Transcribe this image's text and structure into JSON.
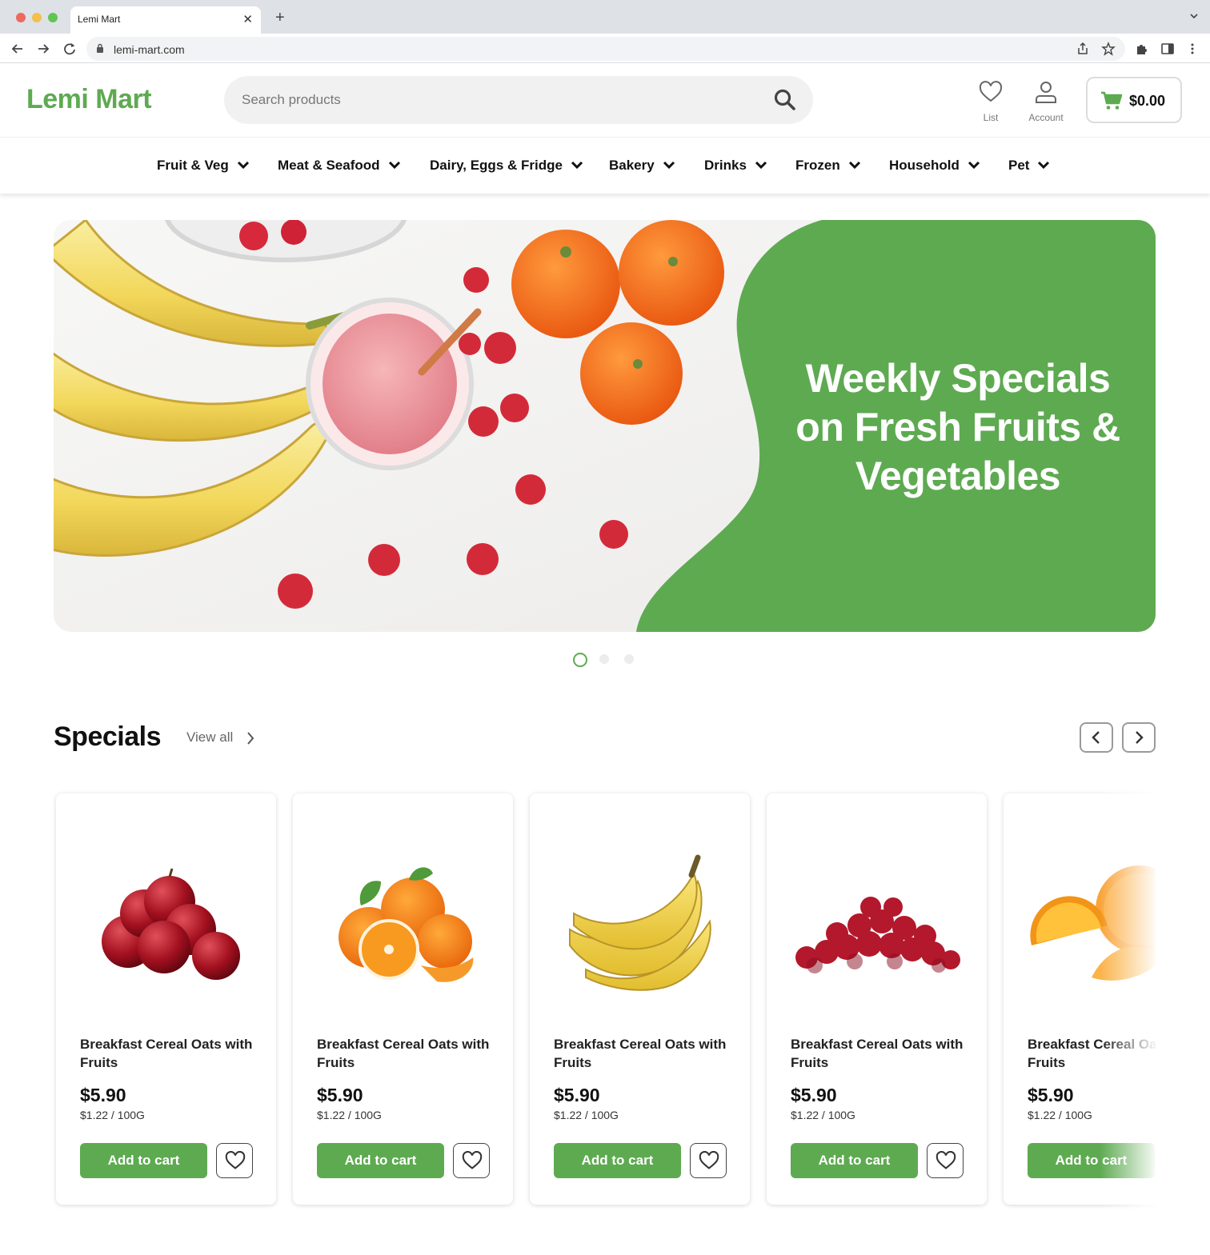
{
  "browser": {
    "tab_title": "Lemi Mart",
    "url": "lemi-mart.com"
  },
  "header": {
    "logo": "Lemi Mart",
    "search_placeholder": "Search products",
    "list_label": "List",
    "account_label": "Account",
    "cart_total": "$0.00"
  },
  "categories": [
    "Fruit & Veg",
    "Meat & Seafood",
    "Dairy, Eggs & Fridge",
    "Bakery",
    "Drinks",
    "Frozen",
    "Household",
    "Pet"
  ],
  "hero": {
    "headline_line1": "Weekly Specials",
    "headline_line2": "on Fresh Fruits &",
    "headline_line3": "Vegetables",
    "slides_total": 3,
    "active_slide": 1
  },
  "specials": {
    "title": "Specials",
    "view_all": "View all",
    "products": [
      {
        "name": "Breakfast Cereal Oats with Fruits",
        "price": "$5.90",
        "unit_price": "$1.22 / 100G",
        "image": "apples",
        "add_label": "Add to cart"
      },
      {
        "name": "Breakfast Cereal Oats with Fruits",
        "price": "$5.90",
        "unit_price": "$1.22 / 100G",
        "image": "mandarins",
        "add_label": "Add to cart"
      },
      {
        "name": "Breakfast Cereal Oats with Fruits",
        "price": "$5.90",
        "unit_price": "$1.22 / 100G",
        "image": "bananas",
        "add_label": "Add to cart"
      },
      {
        "name": "Breakfast Cereal Oats with Fruits",
        "price": "$5.90",
        "unit_price": "$1.22 / 100G",
        "image": "raspberries",
        "add_label": "Add to cart"
      },
      {
        "name": "Breakfast Cereal Oats with Fruits",
        "price": "$5.90",
        "unit_price": "$1.22 / 100G",
        "image": "oranges",
        "add_label": "Add to cart"
      }
    ]
  },
  "colors": {
    "brand_green": "#5eaa51",
    "text_dark": "#111111"
  }
}
